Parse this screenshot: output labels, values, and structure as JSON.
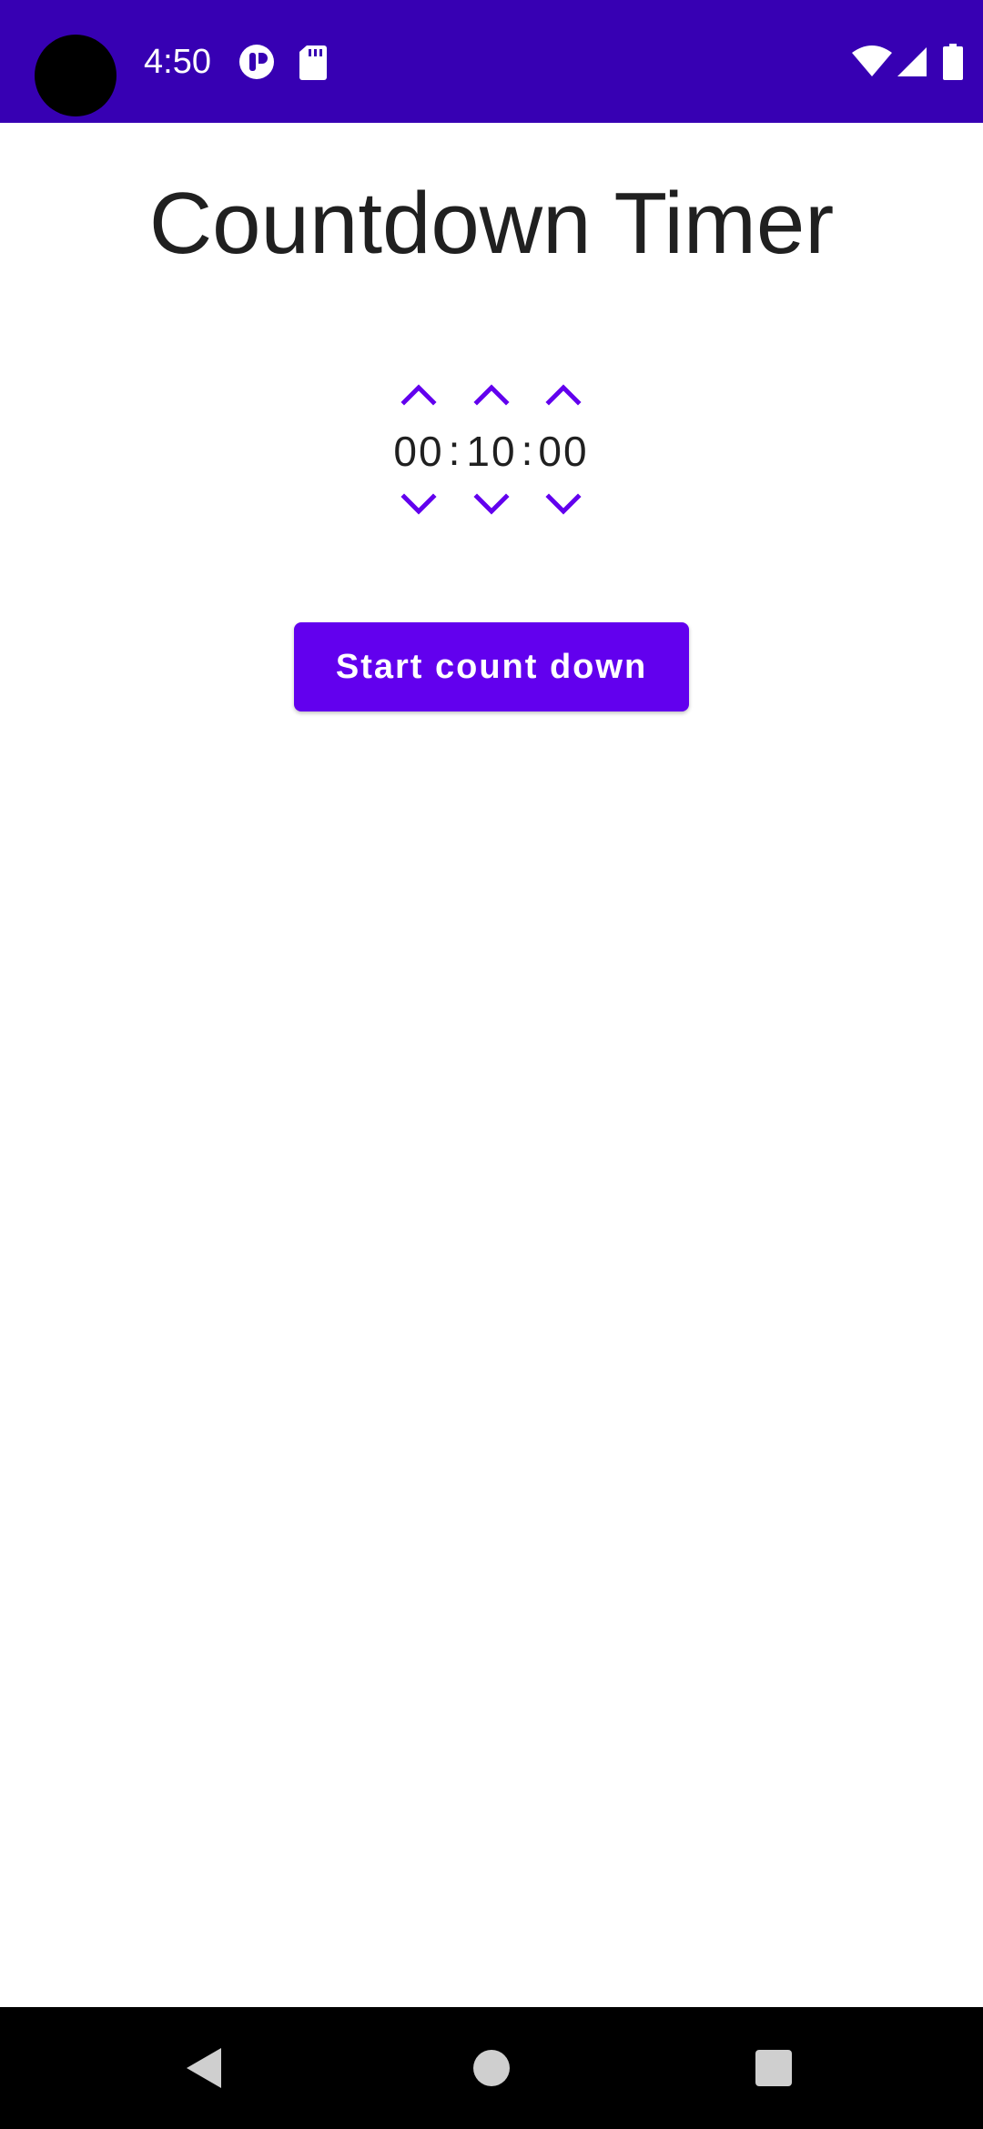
{
  "status_bar": {
    "time": "4:50",
    "background": "#3700B3",
    "icons": [
      "camera-cutout",
      "notification-icon",
      "sd-card-icon",
      "wifi-icon",
      "signal-icon",
      "battery-icon"
    ]
  },
  "header": {
    "title": "Countdown Timer"
  },
  "time_picker": {
    "hours": "00",
    "minutes": "10",
    "seconds": "00",
    "separator": ":",
    "arrow_color": "#6200EE",
    "icons": [
      "chevron-up-icon",
      "chevron-down-icon"
    ]
  },
  "actions": {
    "start_label": "Start count down",
    "button_color": "#6200EE"
  },
  "nav_bar": {
    "icons": [
      "back-icon",
      "home-icon",
      "recents-icon"
    ]
  }
}
